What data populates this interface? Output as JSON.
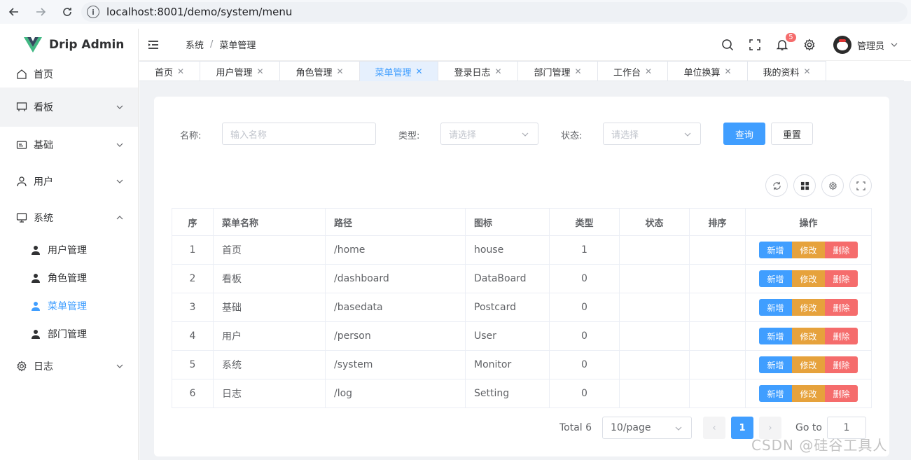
{
  "browser": {
    "url": "localhost:8001/demo/system/menu"
  },
  "sidebar": {
    "app_name": "Drip Admin",
    "home": "首页",
    "items": [
      {
        "label": "看板",
        "icon": "board-icon"
      },
      {
        "label": "基础",
        "icon": "postcard-icon"
      },
      {
        "label": "用户",
        "icon": "user-icon"
      },
      {
        "label": "系统",
        "icon": "monitor-icon"
      },
      {
        "label": "日志",
        "icon": "gear-icon"
      }
    ],
    "sub_items": [
      "用户管理",
      "角色管理",
      "菜单管理",
      "部门管理"
    ],
    "active_sub": "菜单管理"
  },
  "header": {
    "breadcrumb": [
      "系统",
      "菜单管理"
    ],
    "notification_count": "5",
    "username": "管理员"
  },
  "tabs": [
    "首页",
    "用户管理",
    "角色管理",
    "菜单管理",
    "登录日志",
    "部门管理",
    "工作台",
    "单位换算",
    "我的资料"
  ],
  "active_tab": "菜单管理",
  "search": {
    "name_label": "名称:",
    "name_placeholder": "输入名称",
    "type_label": "类型:",
    "type_placeholder": "请选择",
    "status_label": "状态:",
    "status_placeholder": "请选择",
    "query_button": "查询",
    "reset_button": "重置"
  },
  "table": {
    "headers": [
      "序",
      "菜单名称",
      "路径",
      "图标",
      "类型",
      "状态",
      "排序",
      "操作"
    ],
    "rows": [
      {
        "index": "1",
        "name": "首页",
        "path": "/home",
        "icon": "house",
        "type": "1",
        "status": "",
        "sort": ""
      },
      {
        "index": "2",
        "name": "看板",
        "path": "/dashboard",
        "icon": "DataBoard",
        "type": "0",
        "status": "",
        "sort": ""
      },
      {
        "index": "3",
        "name": "基础",
        "path": "/basedata",
        "icon": "Postcard",
        "type": "0",
        "status": "",
        "sort": ""
      },
      {
        "index": "4",
        "name": "用户",
        "path": "/person",
        "icon": "User",
        "type": "0",
        "status": "",
        "sort": ""
      },
      {
        "index": "5",
        "name": "系统",
        "path": "/system",
        "icon": "Monitor",
        "type": "0",
        "status": "",
        "sort": ""
      },
      {
        "index": "6",
        "name": "日志",
        "path": "/log",
        "icon": "Setting",
        "type": "0",
        "status": "",
        "sort": ""
      }
    ],
    "op_add": "新增",
    "op_edit": "修改",
    "op_delete": "删除"
  },
  "pagination": {
    "total": "Total 6",
    "page_size": "10/page",
    "current_page": "1",
    "goto_label": "Go to",
    "goto_value": "1"
  },
  "watermark": "CSDN @硅谷工具人",
  "colors": {
    "primary": "#409eff",
    "warning": "#e6a23c",
    "danger": "#f56c6c",
    "logo_green": "#41b883",
    "logo_dark": "#35495e"
  }
}
